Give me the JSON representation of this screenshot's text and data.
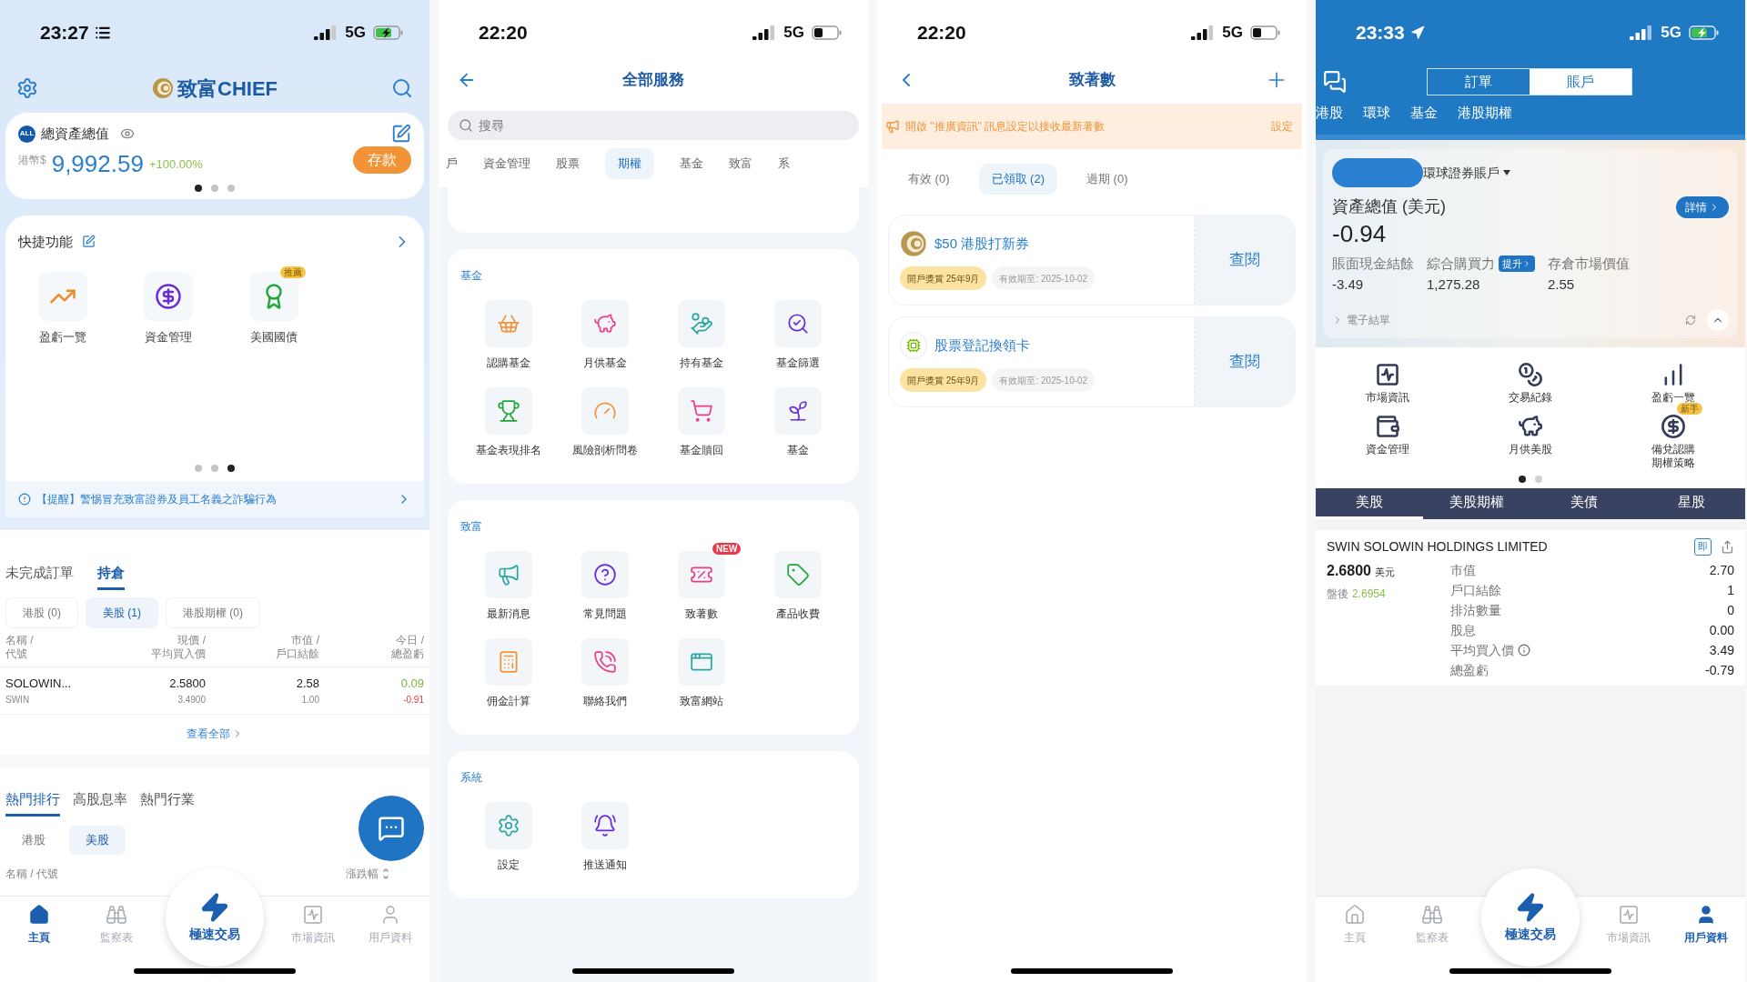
{
  "home": {
    "status": {
      "time": "23:27",
      "network": "5G"
    },
    "brand": "致富CHIEF",
    "asset_card": {
      "badge": "ALL",
      "title": "總資產總值",
      "currency": "港幣$",
      "amount": "9,992.59",
      "change": "+100.00%",
      "button": "存款",
      "pager": [
        {
          "selected": true
        },
        {
          "selected": false
        },
        {
          "selected": false
        }
      ]
    },
    "quick": {
      "title": "快捷功能",
      "items": [
        {
          "label": "盈虧一覽"
        },
        {
          "label": "資金管理"
        },
        {
          "label": "美國國債",
          "badge": "推薦"
        }
      ],
      "pager": [
        {
          "selected": false
        },
        {
          "selected": false
        },
        {
          "selected": true
        }
      ]
    },
    "notice": "【提醒】警惕冒充致富證券及員工名義之詐騙行為",
    "order_tabs": [
      {
        "label": "未完成訂單",
        "selected": false
      },
      {
        "label": "持倉",
        "selected": true
      }
    ],
    "filters": [
      {
        "label": "港股 (0)",
        "selected": false
      },
      {
        "label": "美股 (1)",
        "selected": true
      },
      {
        "label": "港股期權 (0)",
        "selected": false
      }
    ],
    "columns": [
      {
        "lines": [
          "名稱 /",
          "代號"
        ]
      },
      {
        "lines": [
          "現價 /",
          "平均買入價"
        ]
      },
      {
        "lines": [
          "市值 /",
          "戶口結餘"
        ]
      },
      {
        "lines": [
          "今日 /",
          "總盈虧"
        ]
      }
    ],
    "rows": [
      {
        "name": "SOLOWIN...",
        "code": "SWIN",
        "price": "2.5800",
        "avg_price": "3.4900",
        "value": "2.58",
        "balance": "1.00",
        "today": {
          "text": "0.09",
          "kind": "gain"
        },
        "total": {
          "text": "-0.91",
          "kind": "loss"
        }
      }
    ],
    "view_all": "查看全部",
    "rank_tabs": [
      {
        "label": "熱門排行",
        "selected": true
      },
      {
        "label": "高股息率",
        "selected": false
      },
      {
        "label": "熱門行業",
        "selected": false
      }
    ],
    "markets": [
      {
        "label": "港股",
        "selected": false
      },
      {
        "label": "美股",
        "selected": true
      }
    ],
    "list_header": {
      "left": "名稱 / 代號",
      "right": "漲跌幅"
    },
    "nav": {
      "items": [
        {
          "label": "主頁",
          "selected": true
        },
        {
          "label": "監察表",
          "selected": false
        },
        {
          "label": "市場資訊",
          "selected": false
        },
        {
          "label": "用戶資料",
          "selected": false
        }
      ],
      "center": "極速交易"
    }
  },
  "services": {
    "status": {
      "time": "22:20",
      "network": "5G"
    },
    "title": "全部服務",
    "search": {
      "placeholder": "搜尋"
    },
    "tabs": [
      {
        "label": "戶",
        "selected": false
      },
      {
        "label": "資金管理",
        "selected": false
      },
      {
        "label": "股票",
        "selected": false
      },
      {
        "label": "期權",
        "selected": true
      },
      {
        "label": "基金",
        "selected": false
      },
      {
        "label": "致富",
        "selected": false
      },
      {
        "label": "系",
        "selected": false
      }
    ],
    "sections": [
      {
        "title": "基金",
        "items": [
          {
            "label": "認購基金"
          },
          {
            "label": "月供基金"
          },
          {
            "label": "持有基金"
          },
          {
            "label": "基金篩選"
          },
          {
            "label": "基金表現排名"
          },
          {
            "label": "風險剖析問卷"
          },
          {
            "label": "基金贖回"
          },
          {
            "label": "基金"
          }
        ]
      },
      {
        "title": "致富",
        "items": [
          {
            "label": "最新消息"
          },
          {
            "label": "常見問題"
          },
          {
            "label": "致著數",
            "badge": "NEW"
          },
          {
            "label": "產品收費"
          },
          {
            "label": "佣金計算"
          },
          {
            "label": "聯絡我們"
          },
          {
            "label": "致富網站"
          }
        ]
      },
      {
        "title": "系統",
        "items": [
          {
            "label": "設定"
          },
          {
            "label": "推送通知"
          }
        ]
      }
    ]
  },
  "coupons": {
    "status": {
      "time": "22:20",
      "network": "5G"
    },
    "title": "致著數",
    "banner": {
      "text": "開啟 \"推廣資訊\" 訊息設定以接收最新著數",
      "action": "設定"
    },
    "tabs": [
      {
        "label": "有效 (0)",
        "selected": false
      },
      {
        "label": "已領取 (2)",
        "selected": true
      },
      {
        "label": "過期 (0)",
        "selected": false
      }
    ],
    "items": [
      {
        "kind": "chief",
        "title": "$50 港股打新券",
        "tag": "開戶獎賞 25年9月",
        "expiry": "有效期至: 2025-10-02",
        "action": "查閱"
      },
      {
        "kind": "chip",
        "title": "股票登記換領卡",
        "tag": "開戶獎賞 25年9月",
        "expiry": "有效期至: 2025-10-02",
        "action": "查閱"
      }
    ]
  },
  "account": {
    "status": {
      "time": "23:33",
      "network": "5G"
    },
    "segments": [
      {
        "label": "訂單",
        "selected": false
      },
      {
        "label": "賬戶",
        "selected": true
      }
    ],
    "markets": [
      {
        "label": "港股"
      },
      {
        "label": "環球"
      },
      {
        "label": "基金"
      },
      {
        "label": "港股期權"
      }
    ],
    "card": {
      "account": "環球證券賬戶",
      "title": "資產總值 (美元)",
      "value": "-0.94",
      "detail": "詳情",
      "stats": [
        {
          "label": "賬面現金結餘",
          "value": "-3.49"
        },
        {
          "label": "綜合購買力",
          "value": "1,275.28",
          "badge": "提升"
        },
        {
          "label": "存倉市場價值",
          "value": "2.55"
        }
      ],
      "statement": "電子結單"
    },
    "functions": [
      {
        "label": "市場資訊"
      },
      {
        "label": "交易紀錄"
      },
      {
        "label": "盈虧一覽"
      },
      {
        "label": "資金管理"
      },
      {
        "label": "月供美股"
      },
      {
        "label": "備兌認購期權策略",
        "badge": "新手"
      }
    ],
    "pager": [
      {
        "selected": true
      },
      {
        "selected": false
      }
    ],
    "holding_tabs": [
      {
        "label": "美股",
        "selected": true
      },
      {
        "label": "美股期權",
        "selected": false
      },
      {
        "label": "美債",
        "selected": false
      },
      {
        "label": "星股",
        "selected": false
      }
    ],
    "holding": {
      "name": "SWIN SOLOWIN HOLDINGS LIMITED",
      "quote_badge": "即",
      "price": "2.6800",
      "currency": "美元",
      "after_label": "盤後",
      "after_value": "2.6954",
      "fields": [
        {
          "label": "市值",
          "value": "2.70",
          "info": false
        },
        {
          "label": "戶口結餘",
          "value": "1",
          "info": false
        },
        {
          "label": "排沽數量",
          "value": "0",
          "info": false
        },
        {
          "label": "股息",
          "value": "0.00",
          "info": false
        },
        {
          "label": "平均買入價",
          "value": "3.49",
          "info": true
        },
        {
          "label": "總盈虧",
          "value": "-0.79",
          "info": false
        }
      ]
    },
    "nav": {
      "items": [
        {
          "label": "主頁",
          "selected": false
        },
        {
          "label": "監察表",
          "selected": false
        },
        {
          "label": "市場資訊",
          "selected": false
        },
        {
          "label": "用戶資料",
          "selected": true
        }
      ],
      "center": "極速交易"
    }
  }
}
